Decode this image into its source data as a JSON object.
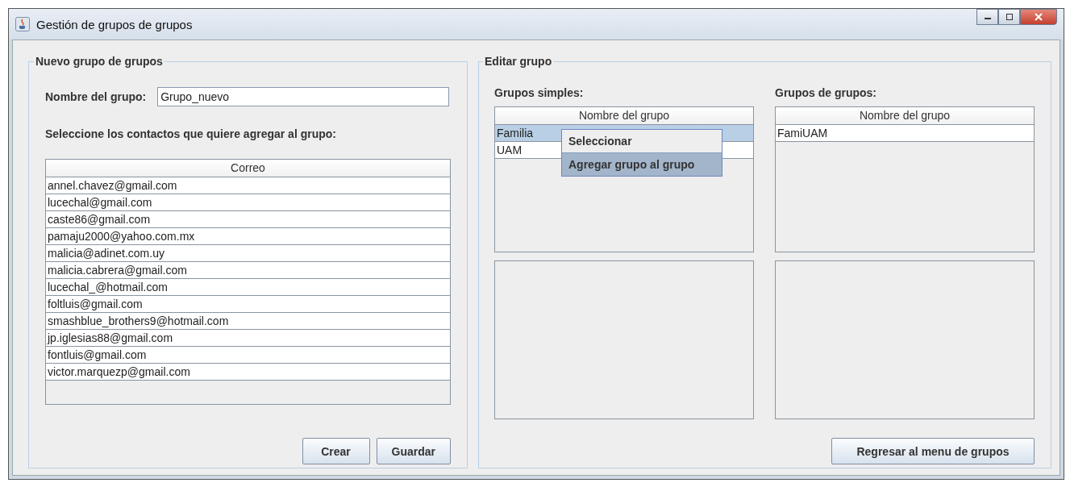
{
  "window": {
    "title": "Gestión de grupos de grupos"
  },
  "new_group": {
    "legend": "Nuevo grupo de grupos",
    "name_label": "Nombre del grupo:",
    "name_value": "Grupo_nuevo",
    "contacts_label": "Seleccione los contactos que quiere agregar al grupo:",
    "table": {
      "columns": [
        "Correo"
      ],
      "rows": [
        {
          "cells": [
            "annel.chavez@gmail.com"
          ],
          "selected": false
        },
        {
          "cells": [
            "lucechal@gmail.com"
          ],
          "selected": false
        },
        {
          "cells": [
            "caste86@gmail.com"
          ],
          "selected": false
        },
        {
          "cells": [
            "pamaju2000@yahoo.com.mx"
          ],
          "selected": false
        },
        {
          "cells": [
            "malicia@adinet.com.uy"
          ],
          "selected": false
        },
        {
          "cells": [
            "malicia.cabrera@gmail.com"
          ],
          "selected": false
        },
        {
          "cells": [
            "lucechal_@hotmail.com"
          ],
          "selected": false
        },
        {
          "cells": [
            "foltluis@gmail.com"
          ],
          "selected": false
        },
        {
          "cells": [
            "smashblue_brothers9@hotmail.com"
          ],
          "selected": false
        },
        {
          "cells": [
            "jp.iglesias88@gmail.com"
          ],
          "selected": false
        },
        {
          "cells": [
            "fontluis@gmail.com"
          ],
          "selected": false
        },
        {
          "cells": [
            "victor.marquezp@gmail.com"
          ],
          "selected": false
        }
      ]
    },
    "buttons": [
      "Crear",
      "Guardar"
    ]
  },
  "edit_group": {
    "legend": "Editar grupo",
    "simple_groups": {
      "label": "Grupos simples:",
      "columns": [
        "Nombre del grupo"
      ],
      "rows": [
        {
          "cells": [
            "Familia"
          ],
          "selected": true
        },
        {
          "cells": [
            "UAM"
          ],
          "selected": false
        }
      ]
    },
    "group_groups": {
      "label": "Grupos de grupos:",
      "columns": [
        "Nombre del grupo"
      ],
      "rows": [
        {
          "cells": [
            "FamiUAM"
          ],
          "selected": false
        }
      ]
    },
    "buttons": [
      "Regresar al menu de grupos"
    ]
  },
  "context_menu": {
    "items": [
      {
        "label": "Seleccionar",
        "selected": false
      },
      {
        "label": "Agregar grupo al grupo",
        "selected": true
      }
    ]
  }
}
